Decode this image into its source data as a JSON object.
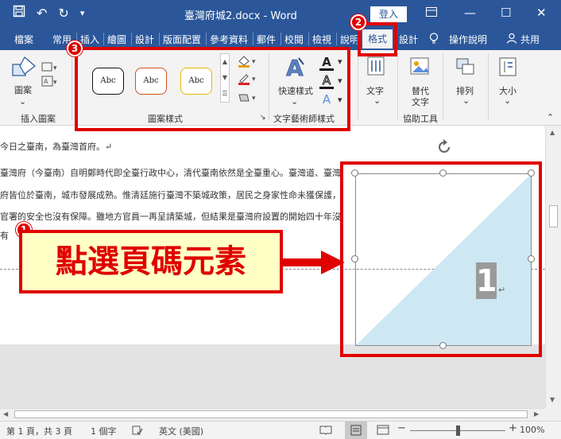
{
  "titlebar": {
    "title": "臺灣府城2.docx - Word",
    "login_label": "登入",
    "qat": [
      "save-icon",
      "undo-icon",
      "redo-icon",
      "customize-icon"
    ]
  },
  "tabs": [
    {
      "label": "檔案"
    },
    {
      "label": "常用"
    },
    {
      "label": "插入"
    },
    {
      "label": "繪圖"
    },
    {
      "label": "設計"
    },
    {
      "label": "版面配置"
    },
    {
      "label": "參考資料"
    },
    {
      "label": "郵件"
    },
    {
      "label": "校閱"
    },
    {
      "label": "檢視"
    },
    {
      "label": "說明"
    },
    {
      "label": "格式",
      "active": true
    },
    {
      "label": "設計"
    }
  ],
  "tell_me": "操作說明",
  "share": "共用",
  "ribbon": {
    "insert_shapes": {
      "shape_label": "圖案",
      "group_label": "插入圖案"
    },
    "shape_styles": {
      "samples": [
        "Abc",
        "Abc",
        "Abc"
      ],
      "group_label": "圖案樣式"
    },
    "wordart": {
      "quick_styles_label": "快速樣式",
      "group_label": "文字藝術師樣式",
      "glyph": "A"
    },
    "text": {
      "label": "文字"
    },
    "alt_text": {
      "label_line1": "替代",
      "label_line2": "文字",
      "group_label": "協助工具"
    },
    "arrange": {
      "label": "排列"
    },
    "size": {
      "label": "大小"
    }
  },
  "document": {
    "lines": [
      "今日之臺南，為臺灣首府。↵",
      "臺灣府（今臺南）自明鄭時代即全臺行政中心，清代臺南依然是全臺重心。臺灣道、臺灣",
      "府皆位於臺南，城市發展成熟。惟清廷施行臺灣不築城政策，居民之身家性命未獲保護，",
      "官署的安全也沒有保障。雖地方官員一再呈請築城，但結果是臺灣府設置的開始四十年沒",
      "有"
    ],
    "page_number": "1",
    "para_mark": "↵"
  },
  "annotations": {
    "badge_1": "1",
    "badge_2": "2",
    "badge_3": "3",
    "callout": "點選頁碼元素"
  },
  "status": {
    "page": "第 1 頁，共 3 頁",
    "words": "1 個字",
    "language": "英文 (美國)",
    "zoom": "100%"
  },
  "colors": {
    "word_blue": "#2b579a",
    "annotation_red": "#e00000",
    "callout_fill": "#ffffc6",
    "triangle_fill": "#cde8f3"
  }
}
